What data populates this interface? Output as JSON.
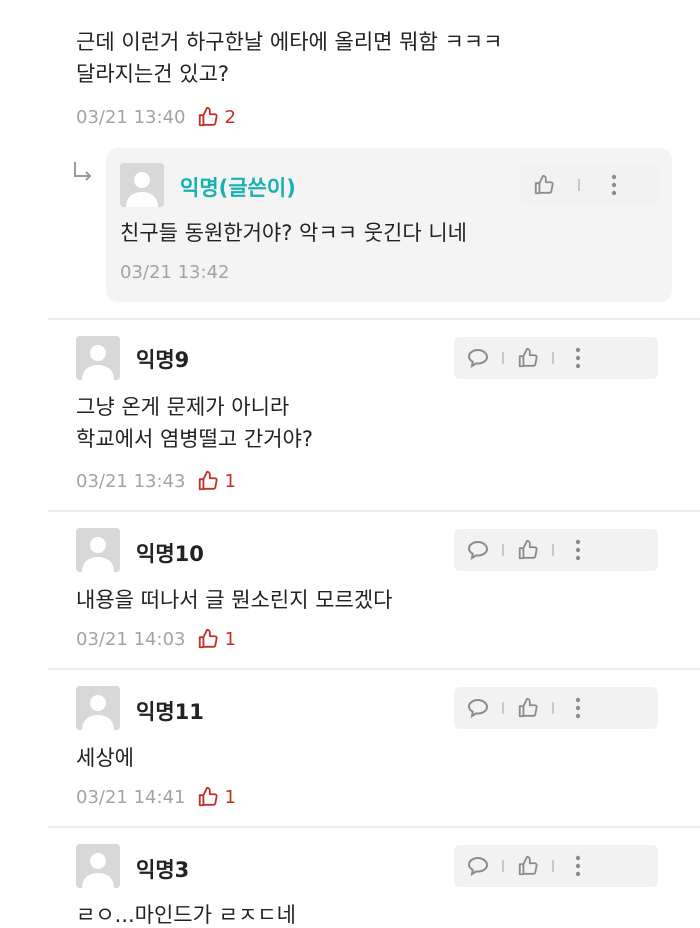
{
  "top_comment": {
    "text_line1": "근데 이런거 하구한날 에타에 올리면 뭐함 ㅋㅋㅋ",
    "text_line2": "달라지는건 있고?",
    "time": "03/21 13:40",
    "likes": "2"
  },
  "reply": {
    "name": "익명(글쓴이)",
    "text": "친구들 동원한거야? 악ㅋㅋ 웃긴다 니네",
    "time": "03/21 13:42"
  },
  "comments": [
    {
      "name": "익명9",
      "line1": "그냥 온게 문제가 아니라",
      "line2": "학교에서 염병떨고 간거야?",
      "time": "03/21 13:43",
      "likes": "1"
    },
    {
      "name": "익명10",
      "line1": "내용을 떠나서 글 뭔소린지 모르겠다",
      "time": "03/21 14:03",
      "likes": "1"
    },
    {
      "name": "익명11",
      "line1": "세상에",
      "time": "03/21 14:41",
      "likes": "1"
    },
    {
      "name": "익명3",
      "line1": "ㄹㅇ...마인드가 ㄹㅈㄷ네"
    }
  ],
  "icons": {
    "reply": "speech-bubble-icon",
    "like": "thumbs-up-icon",
    "more": "more-vertical-icon",
    "avatar": "user-silhouette-icon"
  },
  "colors": {
    "like_red": "#c62f26",
    "writer_teal": "#16b2b2",
    "meta_gray": "#a3a3a3"
  }
}
